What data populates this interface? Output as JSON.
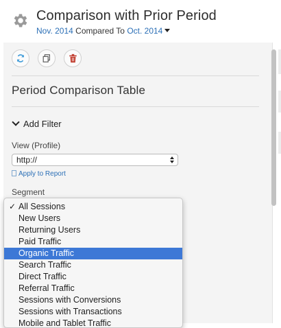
{
  "header": {
    "title": "Comparison with Prior Period",
    "period": "Nov. 2014",
    "compared_to_label": "Compared To",
    "compare_period": "Oct. 2014"
  },
  "toolbar": {
    "refresh_icon": "refresh-icon",
    "copy_icon": "copy-icon",
    "delete_icon": "trash-icon"
  },
  "panel": {
    "section_title": "Period Comparison Table",
    "add_filter_label": "Add Filter",
    "view_label": "View (Profile)",
    "view_value": "http://",
    "apply_link": "Apply to Report",
    "segment_label": "Segment"
  },
  "segment_menu": {
    "selected_index": 4,
    "checked_index": 0,
    "items": [
      "All Sessions",
      "New Users",
      "Returning Users",
      "Paid Traffic",
      "Organic Traffic",
      "Search Traffic",
      "Direct Traffic",
      "Referral Traffic",
      "Sessions with Conversions",
      "Sessions with Transactions",
      "Mobile and Tablet Traffic"
    ]
  },
  "colors": {
    "accent": "#2b6fb6",
    "selection": "#3d78d6",
    "delete": "#c0392b",
    "refresh": "#3c9ad8"
  }
}
